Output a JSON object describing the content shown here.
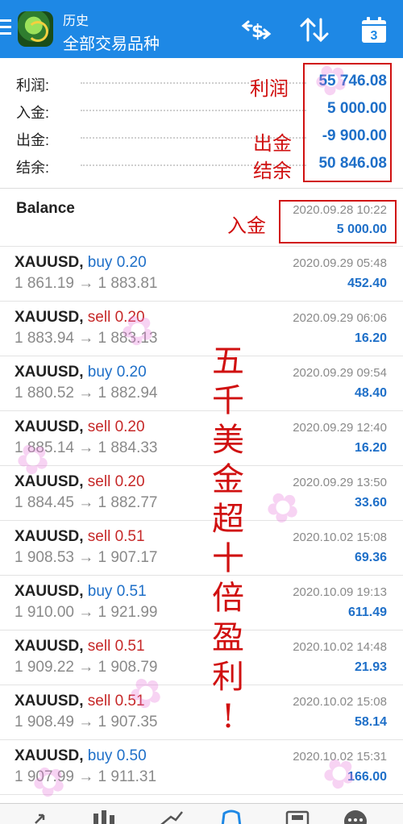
{
  "header": {
    "subtitle": "历史",
    "title": "全部交易品种",
    "icons": [
      "menu-icon",
      "app-logo",
      "exchange-icon",
      "sort-icon",
      "calendar-icon"
    ],
    "calendar_day": "3",
    "accent": "#1e88e5"
  },
  "summary": [
    {
      "label": "利润:",
      "value": "55 746.08"
    },
    {
      "label": "入金:",
      "value": "5 000.00"
    },
    {
      "label": "出金:",
      "value": "-9 900.00"
    },
    {
      "label": "结余:",
      "value": "50 846.08"
    }
  ],
  "annotations": {
    "profit": "利润",
    "withdrawal": "出金",
    "balance": "结余",
    "deposit": "入金",
    "big_text": [
      "五",
      "千",
      "美",
      "金",
      "超",
      "十",
      "倍",
      "盈",
      "利",
      "!"
    ]
  },
  "balance_entry": {
    "title": "Balance",
    "date": "2020.09.28 10:22",
    "amount": "5 000.00"
  },
  "deals": [
    {
      "symbol": "XAUUSD,",
      "side": "buy 0.20",
      "type": "buy",
      "prices": "1 861.19 → 1 883.81",
      "date": "2020.09.29 05:48",
      "profit": "452.40"
    },
    {
      "symbol": "XAUUSD,",
      "side": "sell 0.20",
      "type": "sell",
      "prices": "1 883.94 → 1 883.13",
      "date": "2020.09.29 06:06",
      "profit": "16.20"
    },
    {
      "symbol": "XAUUSD,",
      "side": "buy 0.20",
      "type": "buy",
      "prices": "1 880.52 → 1 882.94",
      "date": "2020.09.29 09:54",
      "profit": "48.40"
    },
    {
      "symbol": "XAUUSD,",
      "side": "sell 0.20",
      "type": "sell",
      "prices": "1 885.14 → 1 884.33",
      "date": "2020.09.29 12:40",
      "profit": "16.20"
    },
    {
      "symbol": "XAUUSD,",
      "side": "sell 0.20",
      "type": "sell",
      "prices": "1 884.45 → 1 882.77",
      "date": "2020.09.29 13:50",
      "profit": "33.60"
    },
    {
      "symbol": "XAUUSD,",
      "side": "sell 0.51",
      "type": "sell",
      "prices": "1 908.53 → 1 907.17",
      "date": "2020.10.02 15:08",
      "profit": "69.36"
    },
    {
      "symbol": "XAUUSD,",
      "side": "buy 0.51",
      "type": "buy",
      "prices": "1 910.00 → 1 921.99",
      "date": "2020.10.09 19:13",
      "profit": "611.49"
    },
    {
      "symbol": "XAUUSD,",
      "side": "sell 0.51",
      "type": "sell",
      "prices": "1 909.22 → 1 908.79",
      "date": "2020.10.02 14:48",
      "profit": "21.93"
    },
    {
      "symbol": "XAUUSD,",
      "side": "sell 0.51",
      "type": "sell",
      "prices": "1 908.49 → 1 907.35",
      "date": "2020.10.02 15:08",
      "profit": "58.14"
    },
    {
      "symbol": "XAUUSD,",
      "side": "buy 0.50",
      "type": "buy",
      "prices": "1 907.99 → 1 911.31",
      "date": "2020.10.02 15:31",
      "profit": "166.00"
    }
  ],
  "bottom_nav": [
    "quotes-icon",
    "chart-icon",
    "trade-icon",
    "history-icon",
    "news-icon",
    "more-icon"
  ],
  "colors": {
    "value_blue": "#1e6fc8",
    "sell_red": "#c62828",
    "annotation_red": "#d01010"
  }
}
